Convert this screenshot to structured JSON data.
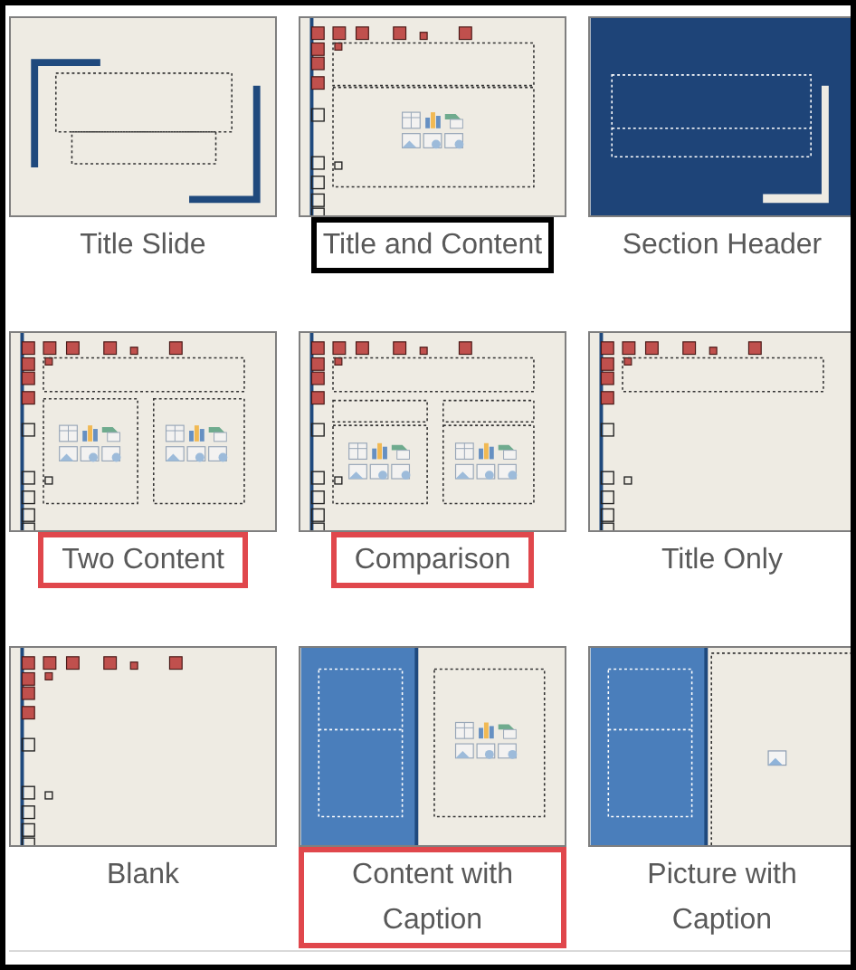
{
  "layouts": [
    {
      "label": "Title Slide",
      "kind": "title-slide",
      "highlighted": false
    },
    {
      "label": "Title and Content",
      "kind": "title-content",
      "highlighted": true,
      "color": "#000000"
    },
    {
      "label": "Section Header",
      "kind": "section-header",
      "highlighted": false
    },
    {
      "label": "Two Content",
      "kind": "two-content",
      "highlighted": true,
      "color": "#e0474c"
    },
    {
      "label": "Comparison",
      "kind": "comparison",
      "highlighted": true,
      "color": "#e0474c"
    },
    {
      "label": "Title Only",
      "kind": "title-only",
      "highlighted": false
    },
    {
      "label": "Blank",
      "kind": "blank",
      "highlighted": false
    },
    {
      "label": "Content with Caption",
      "kind": "content-caption",
      "highlighted": true,
      "color": "#e0474c"
    },
    {
      "label": "Picture with Caption",
      "kind": "picture-caption",
      "highlighted": false
    }
  ]
}
